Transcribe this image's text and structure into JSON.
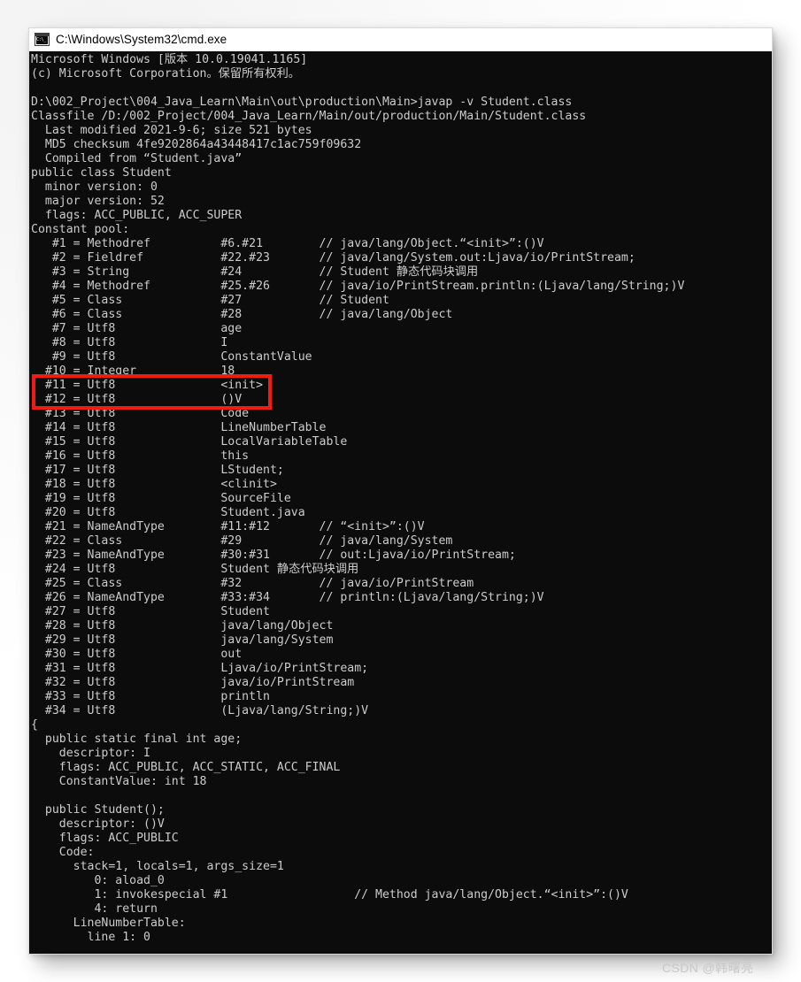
{
  "window": {
    "title": "C:\\Windows\\System32\\cmd.exe",
    "icon": "cmd-icon",
    "background_color": "#0c0c0c",
    "text_color": "#cccccc",
    "titlebar_color": "#ffffff"
  },
  "annotation": {
    "highlight_color": "#ef1c15",
    "highlighted_row": "#10 = Integer                18"
  },
  "watermark": {
    "text": "CSDN @韩曙亮"
  },
  "console": {
    "lines": [
      "Microsoft Windows [版本 10.0.19041.1165]",
      "(c) Microsoft Corporation。保留所有权利。",
      "",
      "D:\\002_Project\\004_Java_Learn\\Main\\out\\production\\Main>javap -v Student.class",
      "Classfile /D:/002_Project/004_Java_Learn/Main/out/production/Main/Student.class",
      "  Last modified 2021-9-6; size 521 bytes",
      "  MD5 checksum 4fe9202864a43448417c1ac759f09632",
      "  Compiled from “Student.java”",
      "public class Student",
      "  minor version: 0",
      "  major version: 52",
      "  flags: ACC_PUBLIC, ACC_SUPER",
      "Constant pool:",
      "   #1 = Methodref          #6.#21        // java/lang/Object.“<init>”:()V",
      "   #2 = Fieldref           #22.#23       // java/lang/System.out:Ljava/io/PrintStream;",
      "   #3 = String             #24           // Student 静态代码块调用",
      "   #4 = Methodref          #25.#26       // java/io/PrintStream.println:(Ljava/lang/String;)V",
      "   #5 = Class              #27           // Student",
      "   #6 = Class              #28           // java/lang/Object",
      "   #7 = Utf8               age",
      "   #8 = Utf8               I",
      "   #9 = Utf8               ConstantValue",
      "  #10 = Integer            18",
      "  #11 = Utf8               <init>",
      "  #12 = Utf8               ()V",
      "  #13 = Utf8               Code",
      "  #14 = Utf8               LineNumberTable",
      "  #15 = Utf8               LocalVariableTable",
      "  #16 = Utf8               this",
      "  #17 = Utf8               LStudent;",
      "  #18 = Utf8               <clinit>",
      "  #19 = Utf8               SourceFile",
      "  #20 = Utf8               Student.java",
      "  #21 = NameAndType        #11:#12       // “<init>”:()V",
      "  #22 = Class              #29           // java/lang/System",
      "  #23 = NameAndType        #30:#31       // out:Ljava/io/PrintStream;",
      "  #24 = Utf8               Student 静态代码块调用",
      "  #25 = Class              #32           // java/io/PrintStream",
      "  #26 = NameAndType        #33:#34       // println:(Ljava/lang/String;)V",
      "  #27 = Utf8               Student",
      "  #28 = Utf8               java/lang/Object",
      "  #29 = Utf8               java/lang/System",
      "  #30 = Utf8               out",
      "  #31 = Utf8               Ljava/io/PrintStream;",
      "  #32 = Utf8               java/io/PrintStream",
      "  #33 = Utf8               println",
      "  #34 = Utf8               (Ljava/lang/String;)V",
      "{",
      "  public static final int age;",
      "    descriptor: I",
      "    flags: ACC_PUBLIC, ACC_STATIC, ACC_FINAL",
      "    ConstantValue: int 18",
      "",
      "  public Student();",
      "    descriptor: ()V",
      "    flags: ACC_PUBLIC",
      "    Code:",
      "      stack=1, locals=1, args_size=1",
      "         0: aload_0",
      "         1: invokespecial #1                  // Method java/lang/Object.“<init>”:()V",
      "         4: return",
      "      LineNumberTable:",
      "        line 1: 0"
    ]
  }
}
